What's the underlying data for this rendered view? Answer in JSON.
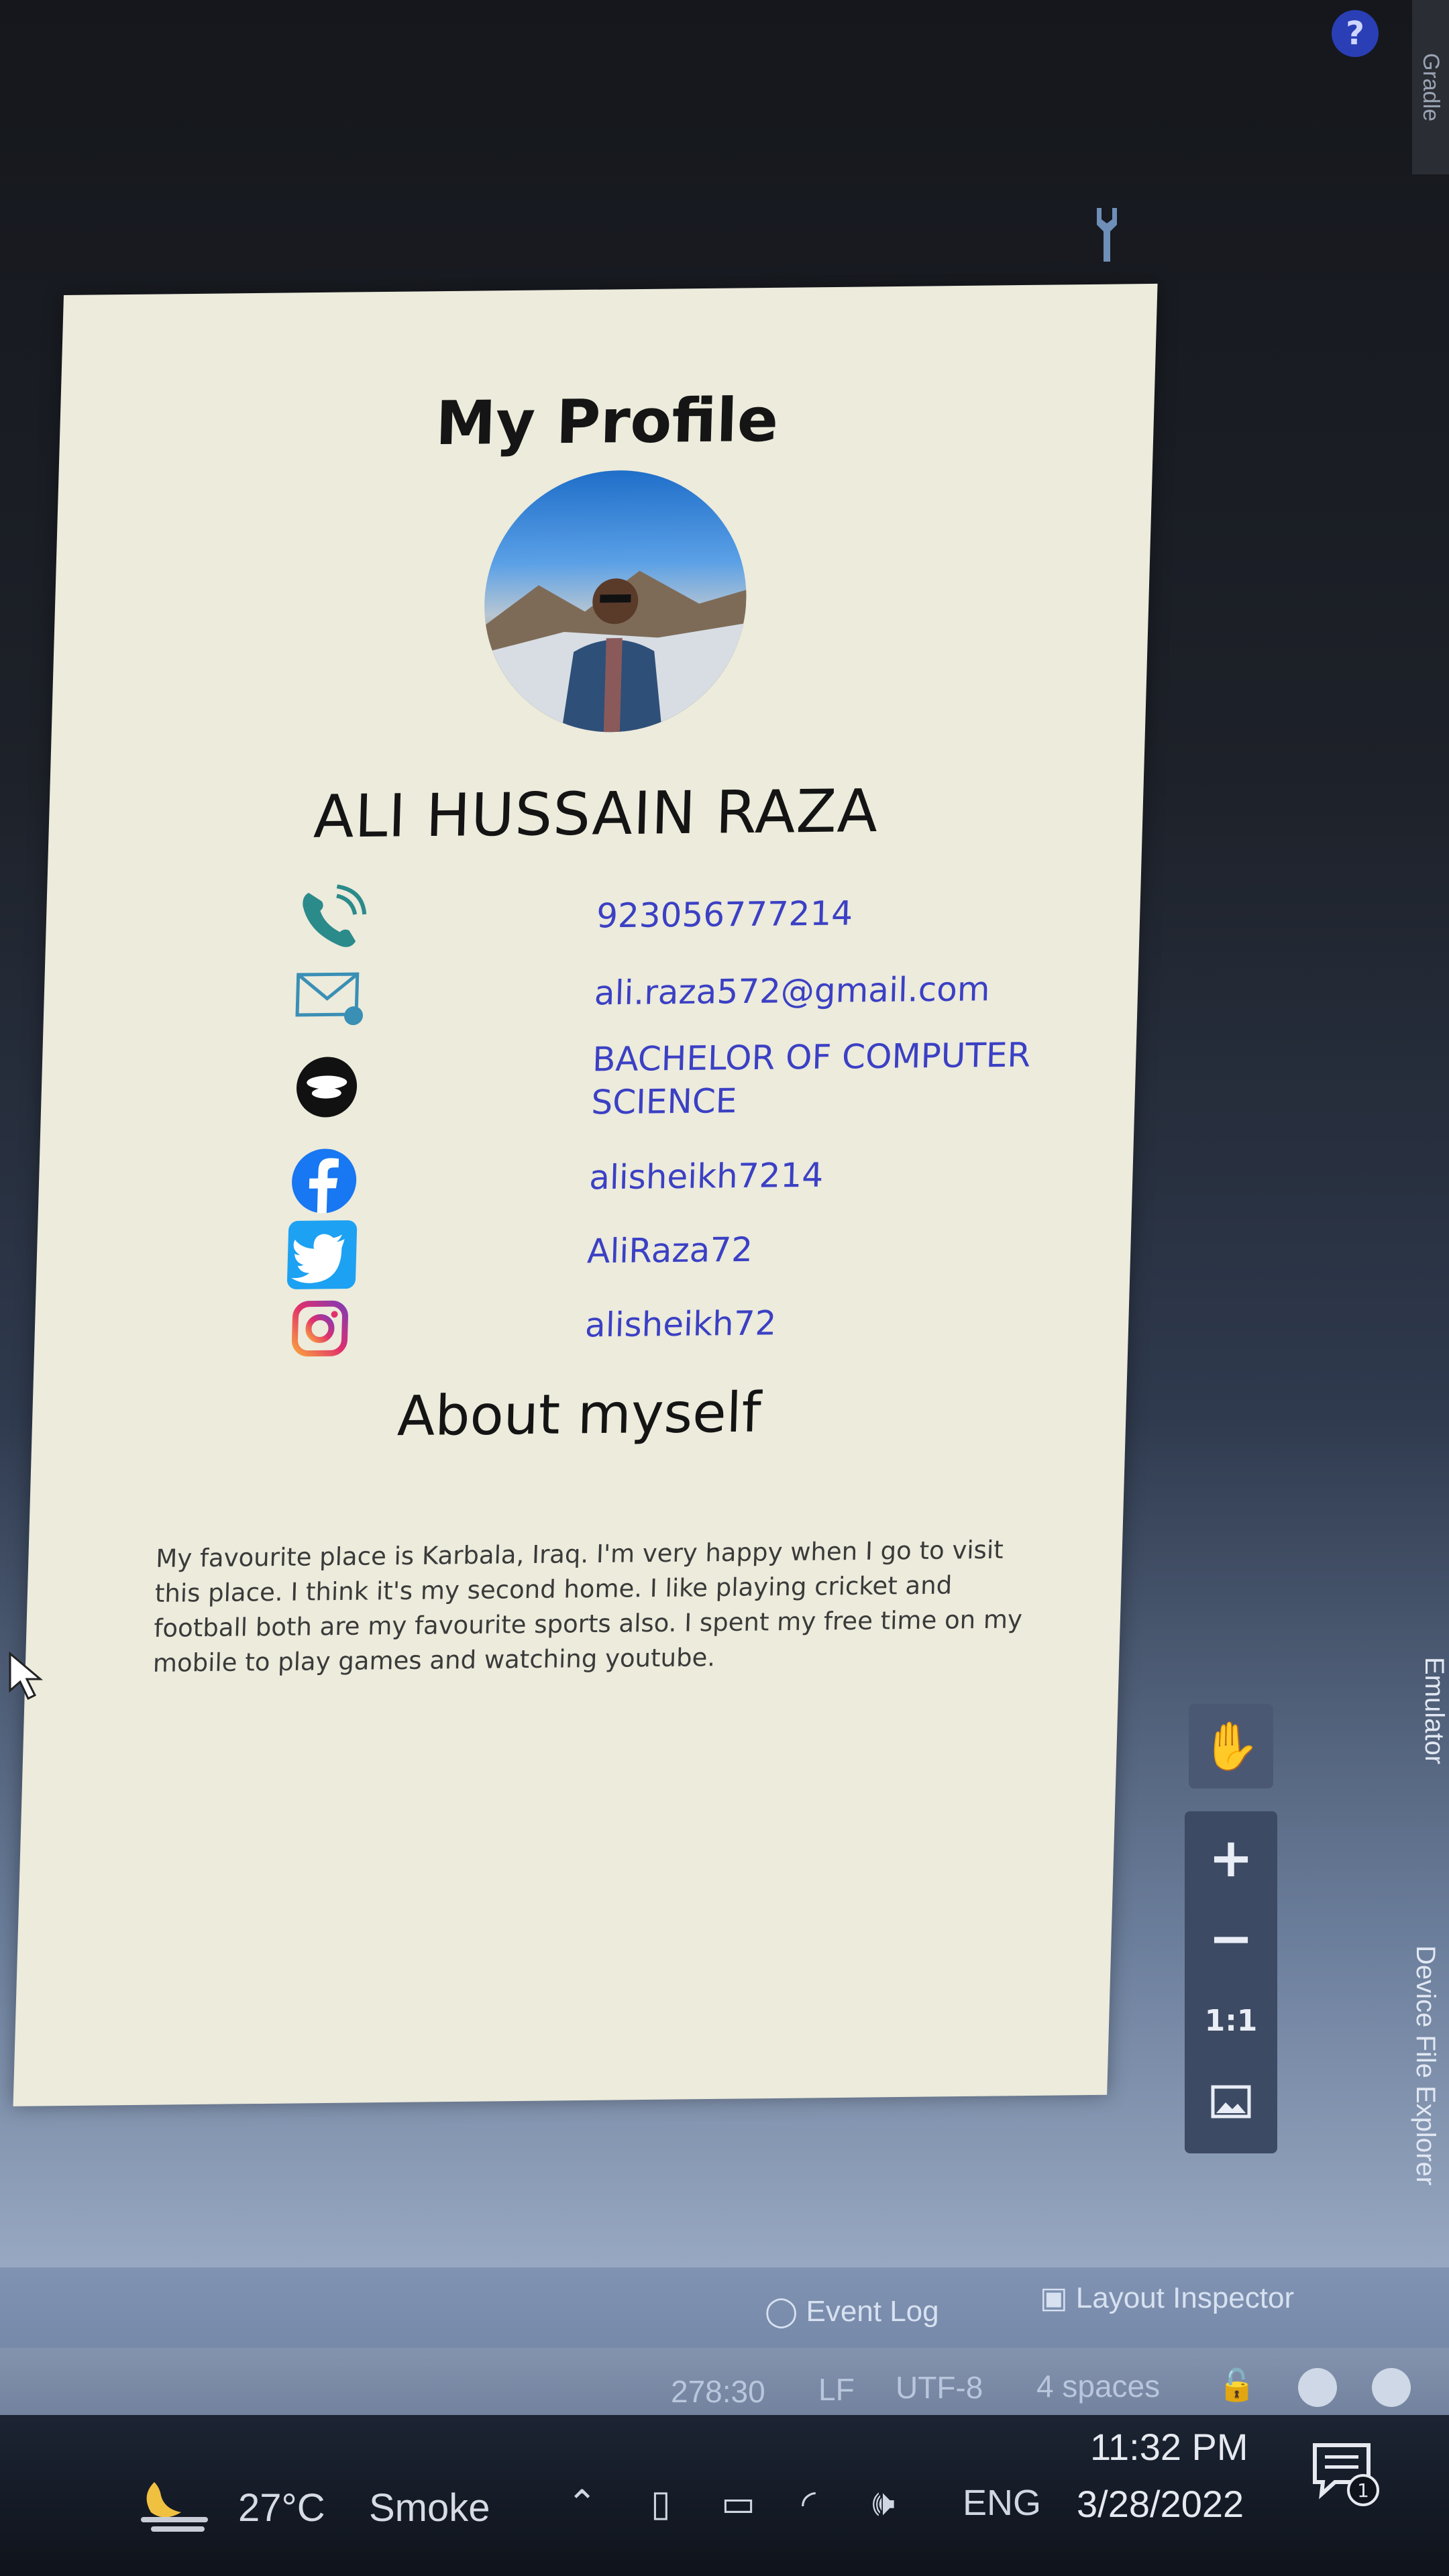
{
  "profile": {
    "title": "My Profile",
    "name": "ALI HUSSAIN RAZA",
    "contacts": [
      {
        "icon": "phone-icon",
        "value": "923056777214"
      },
      {
        "icon": "email-icon",
        "value": "ali.raza572@gmail.com"
      },
      {
        "icon": "education-icon",
        "value": "BACHELOR OF COMPUTER SCIENCE"
      },
      {
        "icon": "facebook-icon",
        "value": "alisheikh7214"
      },
      {
        "icon": "twitter-icon",
        "value": "AliRaza72"
      },
      {
        "icon": "instagram-icon",
        "value": "alisheikh72"
      }
    ],
    "about_title": "About myself",
    "about_text": "My favourite place is Karbala, Iraq. I'm very happy when I go to visit this place. I think it's my second home. I like playing cricket and football both are my favourite sports also. I spent my free time on my mobile to play games and watching youtube.",
    "background": "#ecebdc",
    "link_color": "#3b40c4"
  },
  "ide": {
    "top_side_tab": "Gradle",
    "zoom_controls": {
      "plus": "+",
      "minus": "−",
      "one_to_one": "1:1"
    },
    "side_tabs": [
      "Device File Explorer",
      "Emulator"
    ],
    "tool_windows": {
      "event_log": "Event Log",
      "layout_inspector": "Layout Inspector"
    },
    "status": {
      "position": "278:30",
      "line_sep": "LF",
      "encoding": "UTF-8",
      "indent": "4 spaces"
    }
  },
  "taskbar": {
    "temperature": "27°C",
    "weather": "Smoke",
    "language": "ENG",
    "time": "11:32 PM",
    "date": "3/28/2022",
    "notification_count": "1"
  }
}
